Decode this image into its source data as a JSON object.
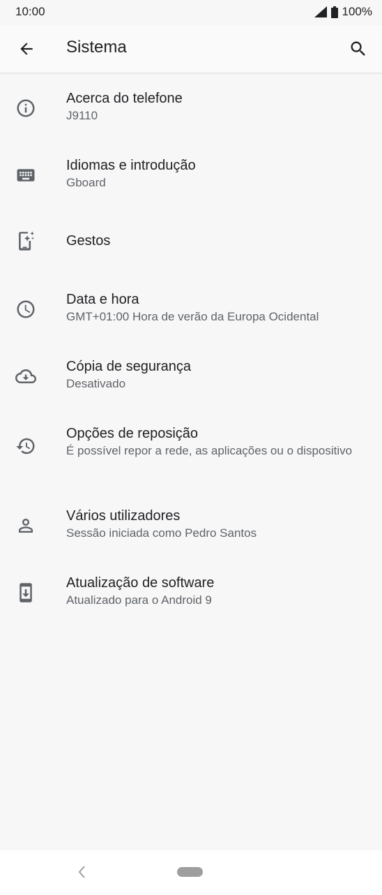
{
  "status_bar": {
    "time": "10:00",
    "battery": "100%",
    "icons": [
      "signal-icon",
      "battery-icon"
    ]
  },
  "header": {
    "title": "Sistema",
    "back_icon": "back-arrow-icon",
    "search_icon": "search-icon"
  },
  "items": [
    {
      "title": "Acerca do telefone",
      "subtitle": "J9110",
      "icon": "info-icon"
    },
    {
      "title": "Idiomas e introdução",
      "subtitle": "Gboard",
      "icon": "keyboard-icon"
    },
    {
      "title": "Gestos",
      "subtitle": "",
      "icon": "gestures-icon"
    },
    {
      "title": "Data e hora",
      "subtitle": "GMT+01:00 Hora de verão da Europa Ocidental",
      "icon": "clock-icon"
    },
    {
      "title": "Cópia de segurança",
      "subtitle": "Desativado",
      "icon": "cloud-backup-icon"
    },
    {
      "title": "Opções de reposição",
      "subtitle": "É possível repor a rede, as aplicações ou o dispositivo",
      "icon": "restore-icon"
    },
    {
      "title": "Vários utilizadores",
      "subtitle": "Sessão iniciada como Pedro Santos",
      "icon": "user-icon"
    },
    {
      "title": "Atualização de software",
      "subtitle": "Atualizado para o Android 9",
      "icon": "system-update-icon"
    }
  ],
  "nav_bar": {
    "back_icon": "nav-back-icon",
    "home_icon": "home-pill-icon"
  },
  "colors": {
    "background": "#f7f7f7",
    "text_primary": "#202124",
    "text_secondary": "#5f6368",
    "icon": "#5f6368"
  }
}
